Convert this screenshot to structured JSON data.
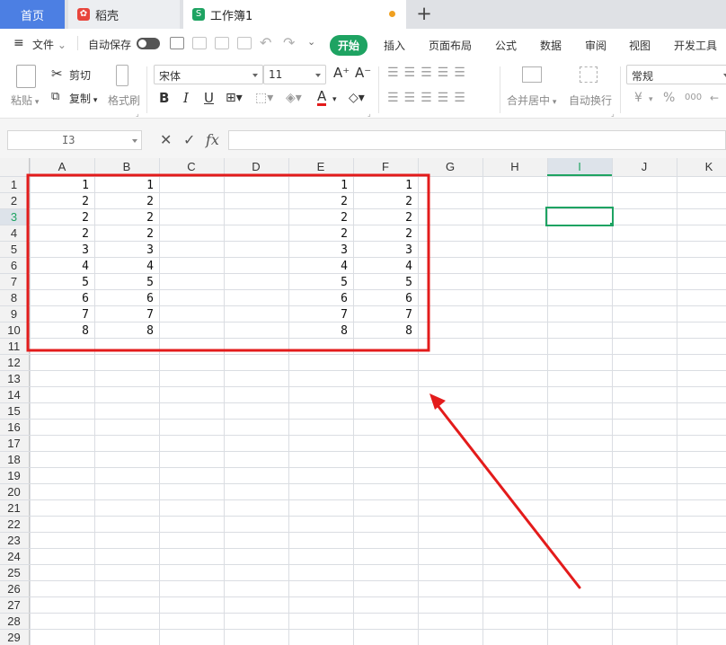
{
  "tabs": {
    "home": "首页",
    "daoke": "稻壳",
    "workbook": "工作簿1",
    "new_tab": "+"
  },
  "menu": {
    "file": "文件",
    "autosave": "自动保存",
    "items": [
      "开始",
      "插入",
      "页面布局",
      "公式",
      "数据",
      "审阅",
      "视图",
      "开发工具"
    ],
    "active_index": 0
  },
  "ribbon": {
    "paste": "粘贴",
    "cut": "剪切",
    "copy": "复制",
    "format_painter": "格式刷",
    "font_name": "宋体",
    "font_size": "11",
    "grow_font": "A⁺",
    "shrink_font": "A⁻",
    "bold": "B",
    "italic": "I",
    "underline": "U",
    "font_color": "A",
    "merge_center": "合并居中",
    "wrap_text": "自动换行",
    "number_format": "常规",
    "currency": "¥",
    "percent": "%",
    "thousands": "000"
  },
  "formula_bar": {
    "name_box": "I3",
    "cancel": "✕",
    "confirm": "✓",
    "fx": "fx",
    "value": ""
  },
  "grid": {
    "columns": [
      "A",
      "B",
      "C",
      "D",
      "E",
      "F",
      "G",
      "H",
      "I",
      "J",
      "K"
    ],
    "rows": [
      "1",
      "2",
      "3",
      "4",
      "5",
      "6",
      "7",
      "8",
      "9",
      "10",
      "11",
      "12",
      "13",
      "14",
      "15",
      "16",
      "17",
      "18",
      "19",
      "20",
      "21",
      "22",
      "23",
      "24",
      "25",
      "26",
      "27",
      "28",
      "29"
    ],
    "selected_cell": "I3",
    "cells": {
      "A1": "1",
      "A2": "2",
      "A3": "2",
      "A4": "2",
      "A5": "3",
      "A6": "4",
      "A7": "5",
      "A8": "6",
      "A9": "7",
      "A10": "8",
      "B1": "1",
      "B2": "2",
      "B3": "2",
      "B4": "2",
      "B5": "3",
      "B6": "4",
      "B7": "5",
      "B8": "6",
      "B9": "7",
      "B10": "8",
      "E1": "1",
      "E2": "2",
      "E3": "2",
      "E4": "2",
      "E5": "3",
      "E6": "4",
      "E7": "5",
      "E8": "6",
      "E9": "7",
      "E10": "8",
      "F1": "1",
      "F2": "2",
      "F3": "2",
      "F4": "2",
      "F5": "3",
      "F6": "4",
      "F7": "5",
      "F8": "6",
      "F9": "7",
      "F10": "8"
    }
  },
  "annotation": {
    "box_color": "#e31b1b",
    "arrow_color": "#e31b1b",
    "box_range": "A1:F11"
  },
  "colors": {
    "home_tab": "#4c7fe3",
    "accent_green": "#1ea362",
    "header_bg": "#f2f2f2",
    "gridline": "#dadde2"
  }
}
